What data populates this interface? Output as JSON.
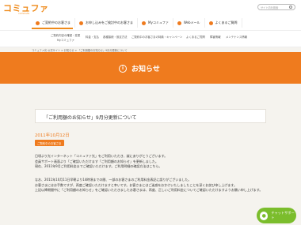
{
  "logo": {
    "main": "コミュファ",
    "sub": "commufa"
  },
  "search": {
    "placeholder": "サイト内を検索"
  },
  "topnav": [
    {
      "label": "ご契約中のお客さま",
      "color": "#ef7b1e"
    },
    {
      "label": "お申し込みをご検討中のお客さま",
      "color": "#ef7b1e"
    },
    {
      "label": "Myコミュファ",
      "color": "#ef7b1e"
    },
    {
      "label": "Webメール",
      "color": "#ef7b1e"
    },
    {
      "label": "よくあるご質問",
      "color": "#ef7b1e"
    }
  ],
  "subnav": [
    "ご契約内容の確認・変更",
    "Myコミュファ",
    "料金・支払",
    "各種接続・設定方法",
    "ご契約中のお客さまの特典・キャンペーン",
    "よくあるご質問",
    "障害情報",
    "メンテナンス情報"
  ],
  "breadcrumb": "コミュファ光 公式サイト > お知らせ > 「ご利用額のお知らせ」9月分更新について",
  "banner": {
    "title": "お知らせ"
  },
  "notice": {
    "title": "「ご利用額のお知らせ」9月分更新について"
  },
  "date": "2011年10月12日",
  "badge": "ご契約中のお客さま",
  "paragraphs": [
    "日頃より光インターネット「コミュファ光」をご利用いただき、誠にありがとうございます。",
    "会員サポート画面より「ご確認いただけます「ご利用額のお知らせ」を更新しました。",
    "現在、2011年9月ご利用料金までご確認いただけます。ご利用明細の確認方法はこちら。",
    "なお、2011年10月11日早朝より14時頃までの間、一部のお客さまのご利用料金表記に誤りがございました。",
    "お客さまにはお手数ですが、再度ご確認いただけますと幸いです。お客さまにはご迷惑をおかけいたしましたことを深くお詫び申し上げます。",
    "上記以降期間中に「ご利用額のお知らせ」をご確認いただきましたお客さまは、再度、正しいご利用料金についてご確認いただけますようお願い申し上げます。"
  ],
  "chat": {
    "label": "チャットサポート"
  }
}
